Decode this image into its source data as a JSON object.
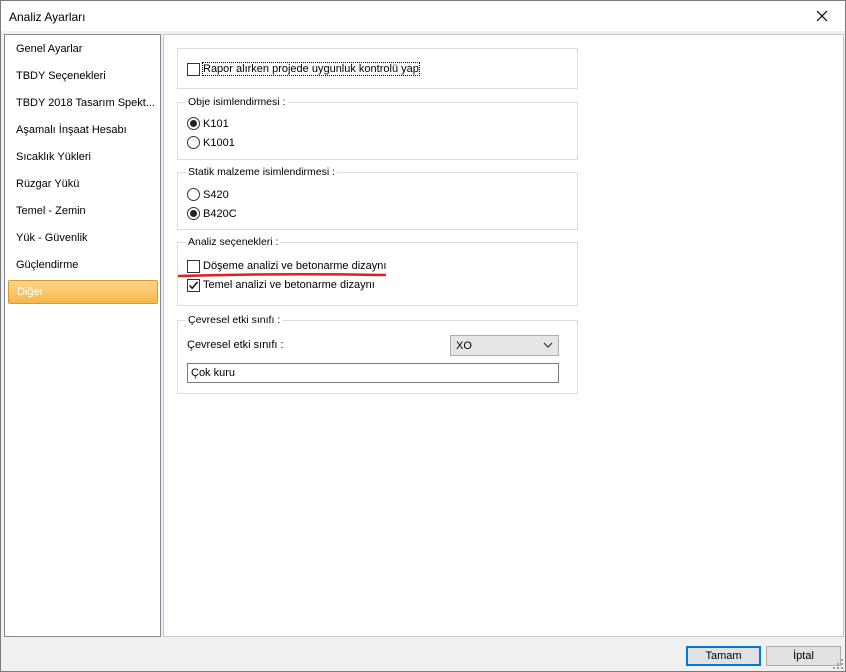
{
  "window": {
    "title": "Analiz Ayarları",
    "close_icon": "close-icon"
  },
  "sidebar": {
    "items": [
      {
        "label": "Genel Ayarlar"
      },
      {
        "label": "TBDY Seçenekleri"
      },
      {
        "label": "TBDY 2018 Tasarım Spekt..."
      },
      {
        "label": "Aşamalı İnşaat Hesabı"
      },
      {
        "label": "Sıcaklık Yükleri"
      },
      {
        "label": "Rüzgar Yükü"
      },
      {
        "label": "Temel - Zemin"
      },
      {
        "label": "Yük - Güvenlik"
      },
      {
        "label": "Güçlendirme"
      },
      {
        "label": "Diğer"
      }
    ],
    "selected": "Diğer"
  },
  "report_group": {
    "check_label": "Rapor alırken projede uygunluk kontrolü yap",
    "checked": false
  },
  "object_naming": {
    "title": "Obje isimlendirmesi :",
    "options": [
      "K101",
      "K1001"
    ],
    "selected": "K101"
  },
  "static_material": {
    "title": "Statik malzeme isimlendirmesi :",
    "options": [
      "S420",
      "B420C"
    ],
    "selected": "B420C"
  },
  "analysis_options": {
    "title": "Analiz seçenekleri  :",
    "slab_label": "Döşeme analizi ve betonarme dizaynı",
    "slab_checked": false,
    "foundation_label": "Temel analizi ve betonarme dizaynı",
    "foundation_checked": true,
    "highlight_color": "#e02020"
  },
  "environment": {
    "title": "Çevresel etki sınıfı :",
    "field_label": "Çevresel etki sınıfı :",
    "select_value": "XO",
    "description": "Çok kuru"
  },
  "footer": {
    "ok_label": "Tamam",
    "cancel_label": "İptal"
  }
}
